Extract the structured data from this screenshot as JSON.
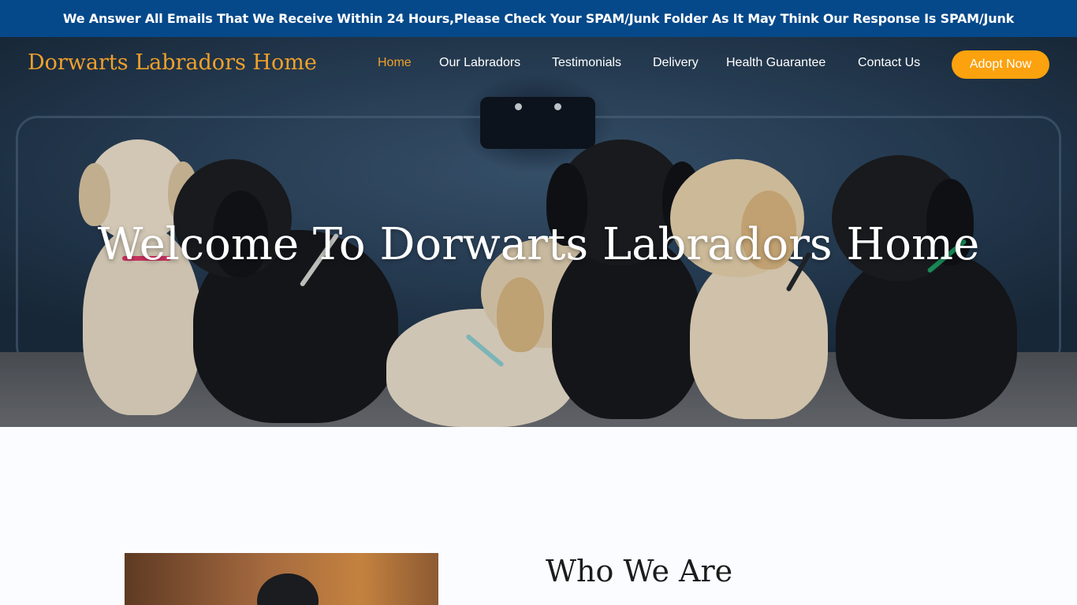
{
  "announcement": {
    "text": "We Answer All Emails That We Receive Within 24 Hours,Please Check Your SPAM/Junk Folder As It May Think Our Response Is SPAM/Junk"
  },
  "header": {
    "brand": "Dorwarts Labradors Home",
    "nav": [
      {
        "label": "Home",
        "active": true
      },
      {
        "label": "Our Labradors",
        "active": false
      },
      {
        "label": "Testimonials",
        "active": false
      },
      {
        "label": "Delivery",
        "active": false
      },
      {
        "label": "Health Guarantee",
        "active": false
      },
      {
        "label": "Contact Us",
        "active": false
      }
    ],
    "cta_label": "Adopt Now"
  },
  "hero": {
    "title": "Welcome To Dorwarts Labradors Home"
  },
  "about": {
    "title": "Who We Are"
  },
  "colors": {
    "announcement_bg": "#05498a",
    "brand": "#f0a12a",
    "active_nav": "#f0a12a",
    "cta_bg": "#fba20e",
    "page_bg": "#fbfcff"
  }
}
